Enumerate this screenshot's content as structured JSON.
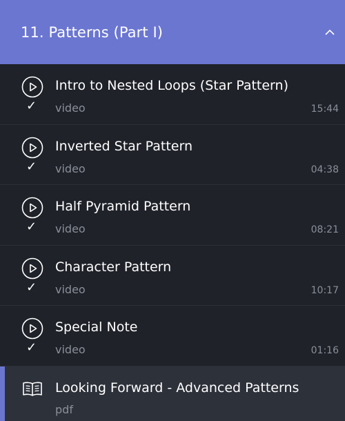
{
  "section": {
    "title": "11. Patterns (Part I)",
    "collapse_icon": "chevron-up-icon"
  },
  "colors": {
    "accent": "#6b76d1",
    "background": "#1f2229",
    "active_background": "#2d313a",
    "muted_text": "#8a8f99"
  },
  "lessons": [
    {
      "title": "Intro to Nested Loops (Star Pattern)",
      "kind": "video",
      "duration": "15:44",
      "icon": "play-circle-icon",
      "completed": "✓"
    },
    {
      "title": "Inverted Star Pattern",
      "kind": "video",
      "duration": "04:38",
      "icon": "play-circle-icon",
      "completed": "✓"
    },
    {
      "title": "Half Pyramid Pattern",
      "kind": "video",
      "duration": "08:21",
      "icon": "play-circle-icon",
      "completed": "✓"
    },
    {
      "title": "Character Pattern",
      "kind": "video",
      "duration": "10:17",
      "icon": "play-circle-icon",
      "completed": "✓"
    },
    {
      "title": "Special Note",
      "kind": "video",
      "duration": "01:16",
      "icon": "play-circle-icon",
      "completed": "✓"
    },
    {
      "title": "Looking Forward - Advanced Patterns",
      "kind": "pdf",
      "icon": "open-book-icon"
    }
  ]
}
